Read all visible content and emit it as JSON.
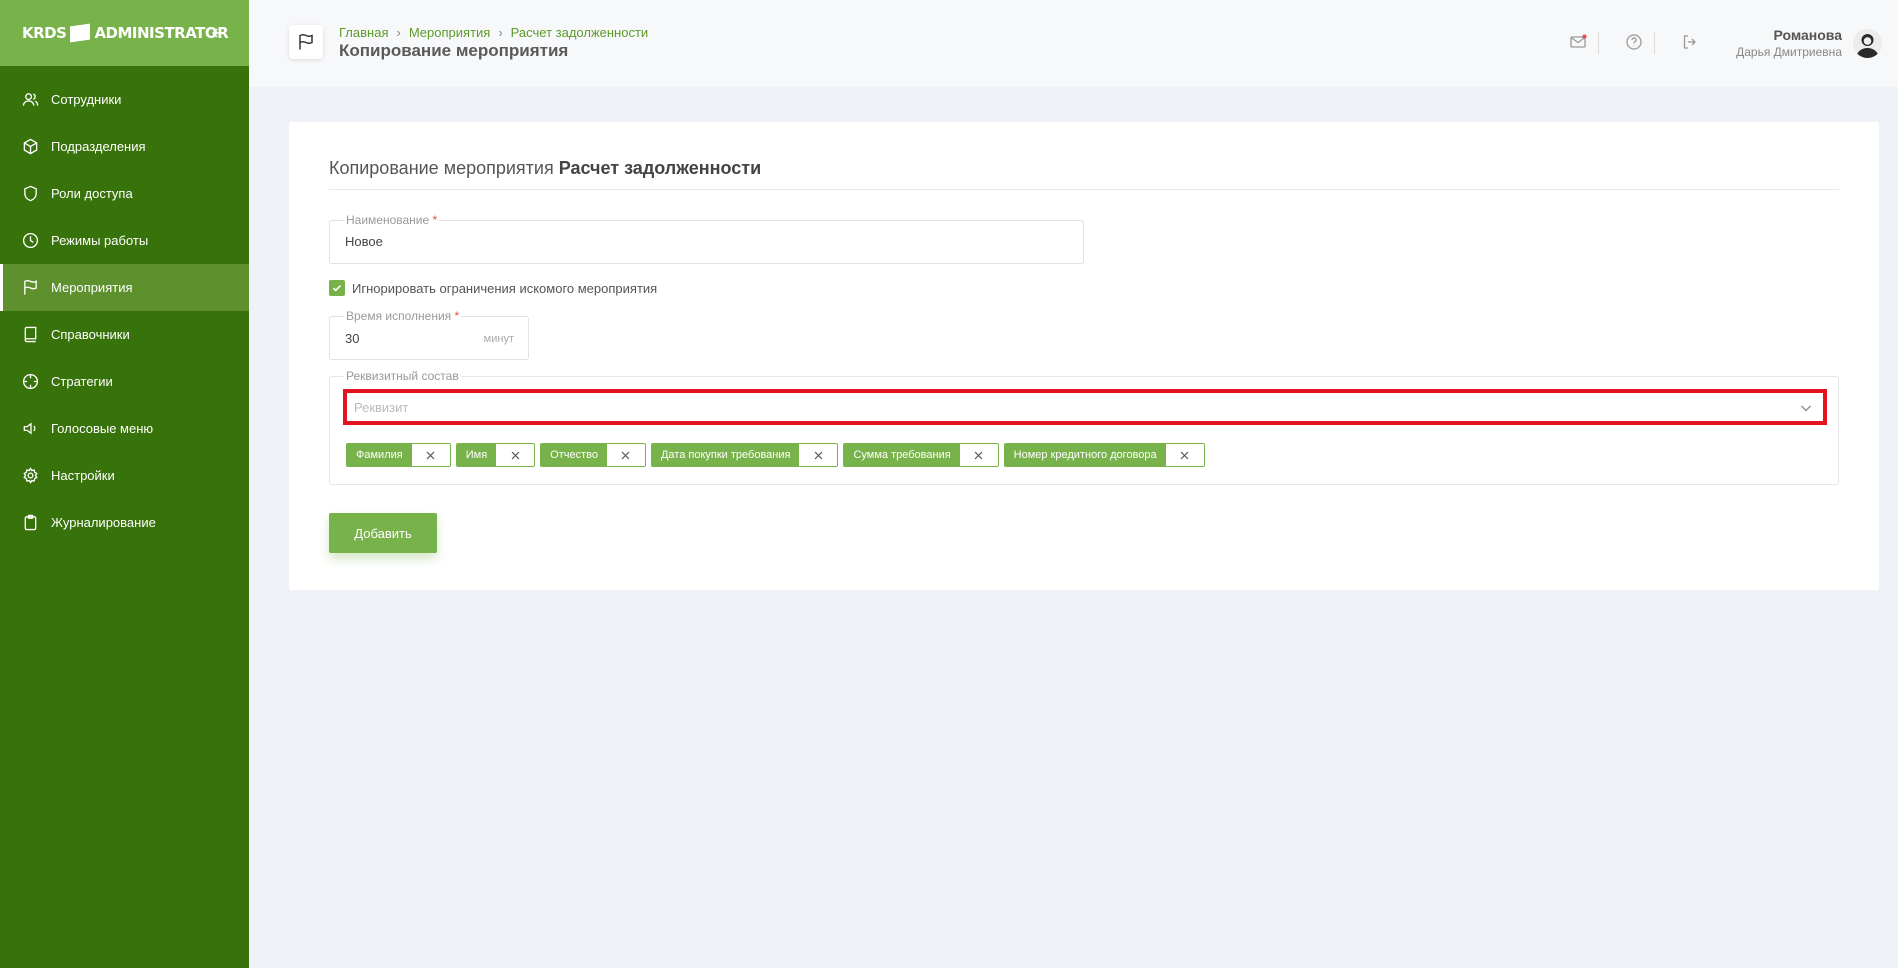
{
  "app": {
    "logo_left": "KRDS",
    "logo_right": "ADMINISTRATOR"
  },
  "sidebar": {
    "items": [
      {
        "label": "Сотрудники",
        "icon": "users-icon"
      },
      {
        "label": "Подразделения",
        "icon": "cube-icon"
      },
      {
        "label": "Роли доступа",
        "icon": "shield-icon"
      },
      {
        "label": "Режимы работы",
        "icon": "clock-icon"
      },
      {
        "label": "Мероприятия",
        "icon": "flag-icon",
        "active": true
      },
      {
        "label": "Справочники",
        "icon": "book-icon"
      },
      {
        "label": "Стратегии",
        "icon": "crosshair-icon"
      },
      {
        "label": "Голосовые меню",
        "icon": "speaker-icon"
      },
      {
        "label": "Настройки",
        "icon": "gear-icon"
      },
      {
        "label": "Журналирование",
        "icon": "clipboard-icon"
      }
    ]
  },
  "header": {
    "breadcrumbs": [
      "Главная",
      "Мероприятия",
      "Расчет задолженности"
    ],
    "title": "Копирование мероприятия",
    "user": {
      "last_name": "Романова",
      "first_name": "Дарья Дмитриевна"
    }
  },
  "form": {
    "title_prefix": "Копирование мероприятия",
    "title_name": "Расчет задолженности",
    "name_field": {
      "label": "Наименование",
      "required_mark": "*",
      "value": "Новое"
    },
    "ignore_checkbox": {
      "label": "Игнорировать ограничения искомого мероприятия",
      "checked": true
    },
    "time_field": {
      "label": "Время исполнения",
      "required_mark": "*",
      "value": "30",
      "unit": "минут"
    },
    "requisites": {
      "label": "Реквизитный состав",
      "select_placeholder": "Реквизит",
      "tags": [
        "Фамилия",
        "Имя",
        "Отчество",
        "Дата покупки требования",
        "Сумма требования",
        "Номер кредитного договора"
      ]
    },
    "add_button": "Добавить"
  },
  "colors": {
    "sidebar": "#38720a",
    "accent": "#78b24a",
    "highlight": "#e3131f"
  }
}
